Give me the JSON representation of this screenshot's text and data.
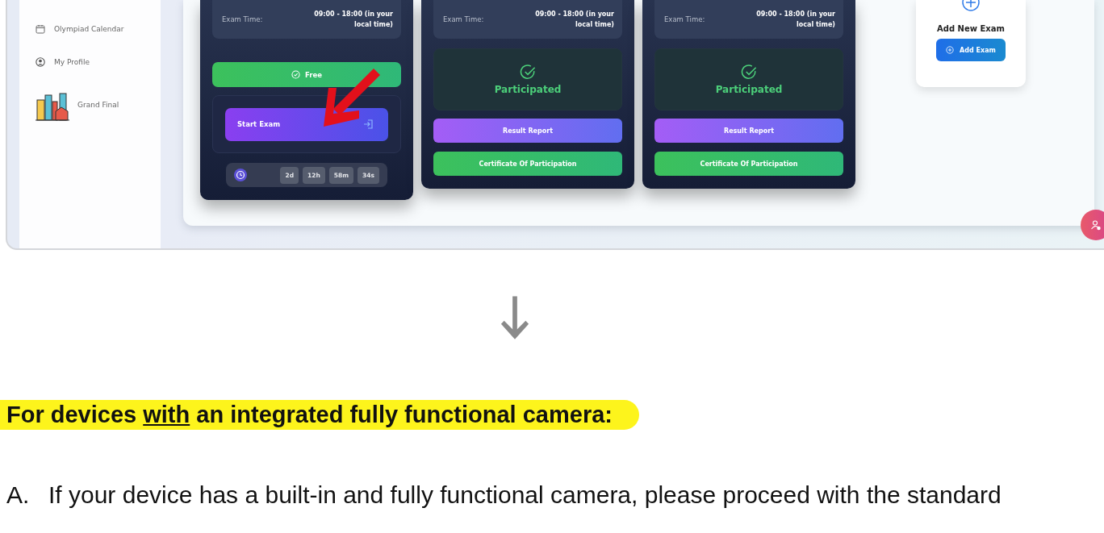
{
  "sidebar": {
    "items": [
      {
        "kind": "calendar",
        "label": "Olympiad Calendar"
      },
      {
        "kind": "profile",
        "label": "My Profile"
      },
      {
        "kind": "city",
        "label": "Grand Final"
      }
    ]
  },
  "exam_cards": [
    {
      "kind": "upcoming",
      "time_label": "Exam Time:",
      "time_value": "09:00 - 18:00 (in your local time)",
      "badge": "Free",
      "action": "Start Exam",
      "countdown": [
        "2d",
        "12h",
        "58m",
        "34s"
      ]
    },
    {
      "kind": "participated",
      "time_label": "Exam Time:",
      "time_value": "09:00 - 18:00 (in your local time)",
      "status": "Participated",
      "buttons": [
        "Result Report",
        "Certificate Of Participation"
      ]
    },
    {
      "kind": "participated",
      "time_label": "Exam Time:",
      "time_value": "09:00 - 18:00 (in your local time)",
      "status": "Participated",
      "buttons": [
        "Result Report",
        "Certificate Of Participation"
      ]
    }
  ],
  "add_card": {
    "title": "Add New Exam",
    "button": "Add Exam"
  },
  "heading": {
    "before": "For devices ",
    "underlined": "with",
    "after": " an integrated fully functional camera:"
  },
  "steps": [
    {
      "marker": "A.",
      "text": "If your device has a built-in and fully functional camera, please proceed with the standard"
    }
  ]
}
